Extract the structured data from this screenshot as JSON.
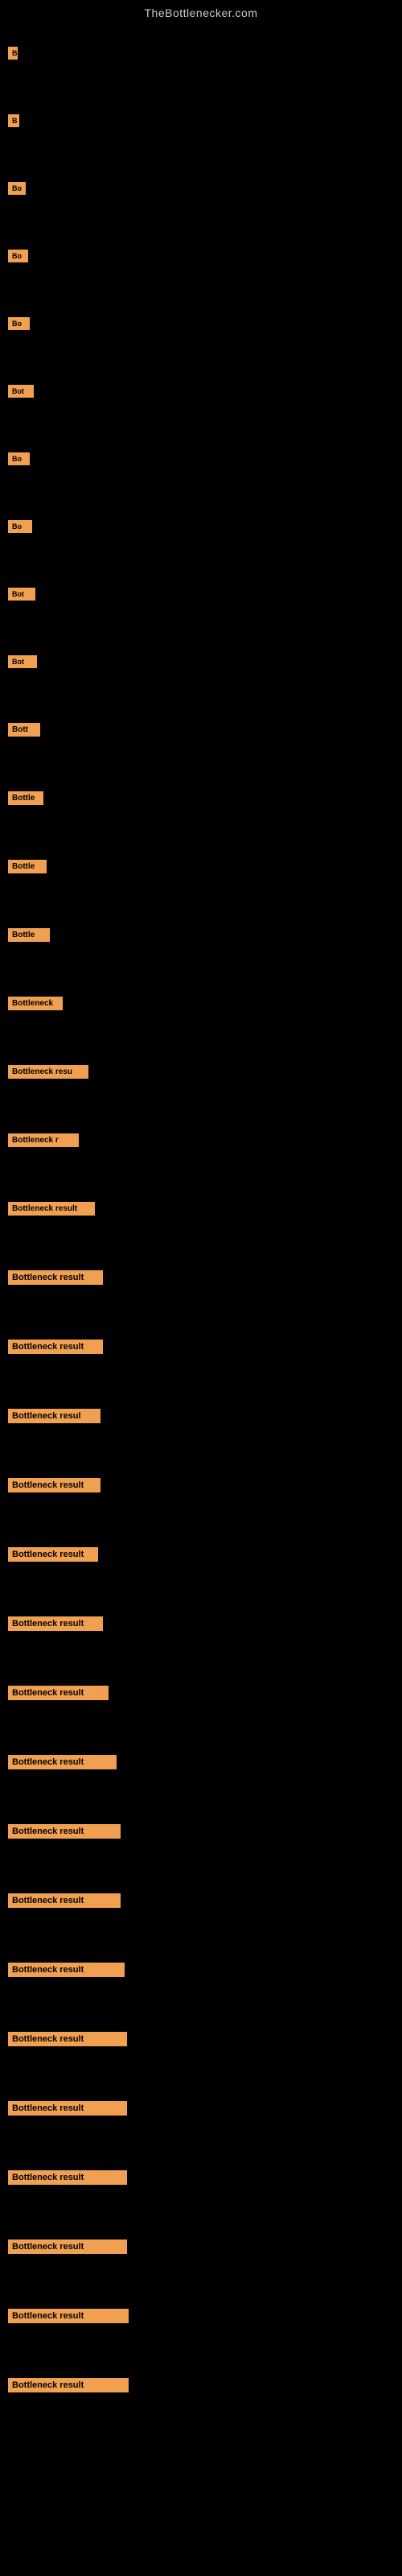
{
  "site": {
    "title": "TheBottlenecker.com"
  },
  "items": [
    {
      "id": 1,
      "label": "B"
    },
    {
      "id": 2,
      "label": "B"
    },
    {
      "id": 3,
      "label": "Bo"
    },
    {
      "id": 4,
      "label": "Bo"
    },
    {
      "id": 5,
      "label": "Bo"
    },
    {
      "id": 6,
      "label": "Bot"
    },
    {
      "id": 7,
      "label": "Bo"
    },
    {
      "id": 8,
      "label": "Bo"
    },
    {
      "id": 9,
      "label": "Bot"
    },
    {
      "id": 10,
      "label": "Bot"
    },
    {
      "id": 11,
      "label": "Bott"
    },
    {
      "id": 12,
      "label": "Bottle"
    },
    {
      "id": 13,
      "label": "Bottle"
    },
    {
      "id": 14,
      "label": "Bottle"
    },
    {
      "id": 15,
      "label": "Bottleneck"
    },
    {
      "id": 16,
      "label": "Bottleneck resu"
    },
    {
      "id": 17,
      "label": "Bottleneck r"
    },
    {
      "id": 18,
      "label": "Bottleneck result"
    },
    {
      "id": 19,
      "label": "Bottleneck result"
    },
    {
      "id": 20,
      "label": "Bottleneck result"
    },
    {
      "id": 21,
      "label": "Bottleneck resul"
    },
    {
      "id": 22,
      "label": "Bottleneck result"
    },
    {
      "id": 23,
      "label": "Bottleneck result"
    },
    {
      "id": 24,
      "label": "Bottleneck result"
    },
    {
      "id": 25,
      "label": "Bottleneck result"
    },
    {
      "id": 26,
      "label": "Bottleneck result"
    },
    {
      "id": 27,
      "label": "Bottleneck result"
    },
    {
      "id": 28,
      "label": "Bottleneck result"
    },
    {
      "id": 29,
      "label": "Bottleneck result"
    },
    {
      "id": 30,
      "label": "Bottleneck result"
    },
    {
      "id": 31,
      "label": "Bottleneck result"
    },
    {
      "id": 32,
      "label": "Bottleneck result"
    },
    {
      "id": 33,
      "label": "Bottleneck result"
    },
    {
      "id": 34,
      "label": "Bottleneck result"
    },
    {
      "id": 35,
      "label": "Bottleneck result"
    }
  ]
}
